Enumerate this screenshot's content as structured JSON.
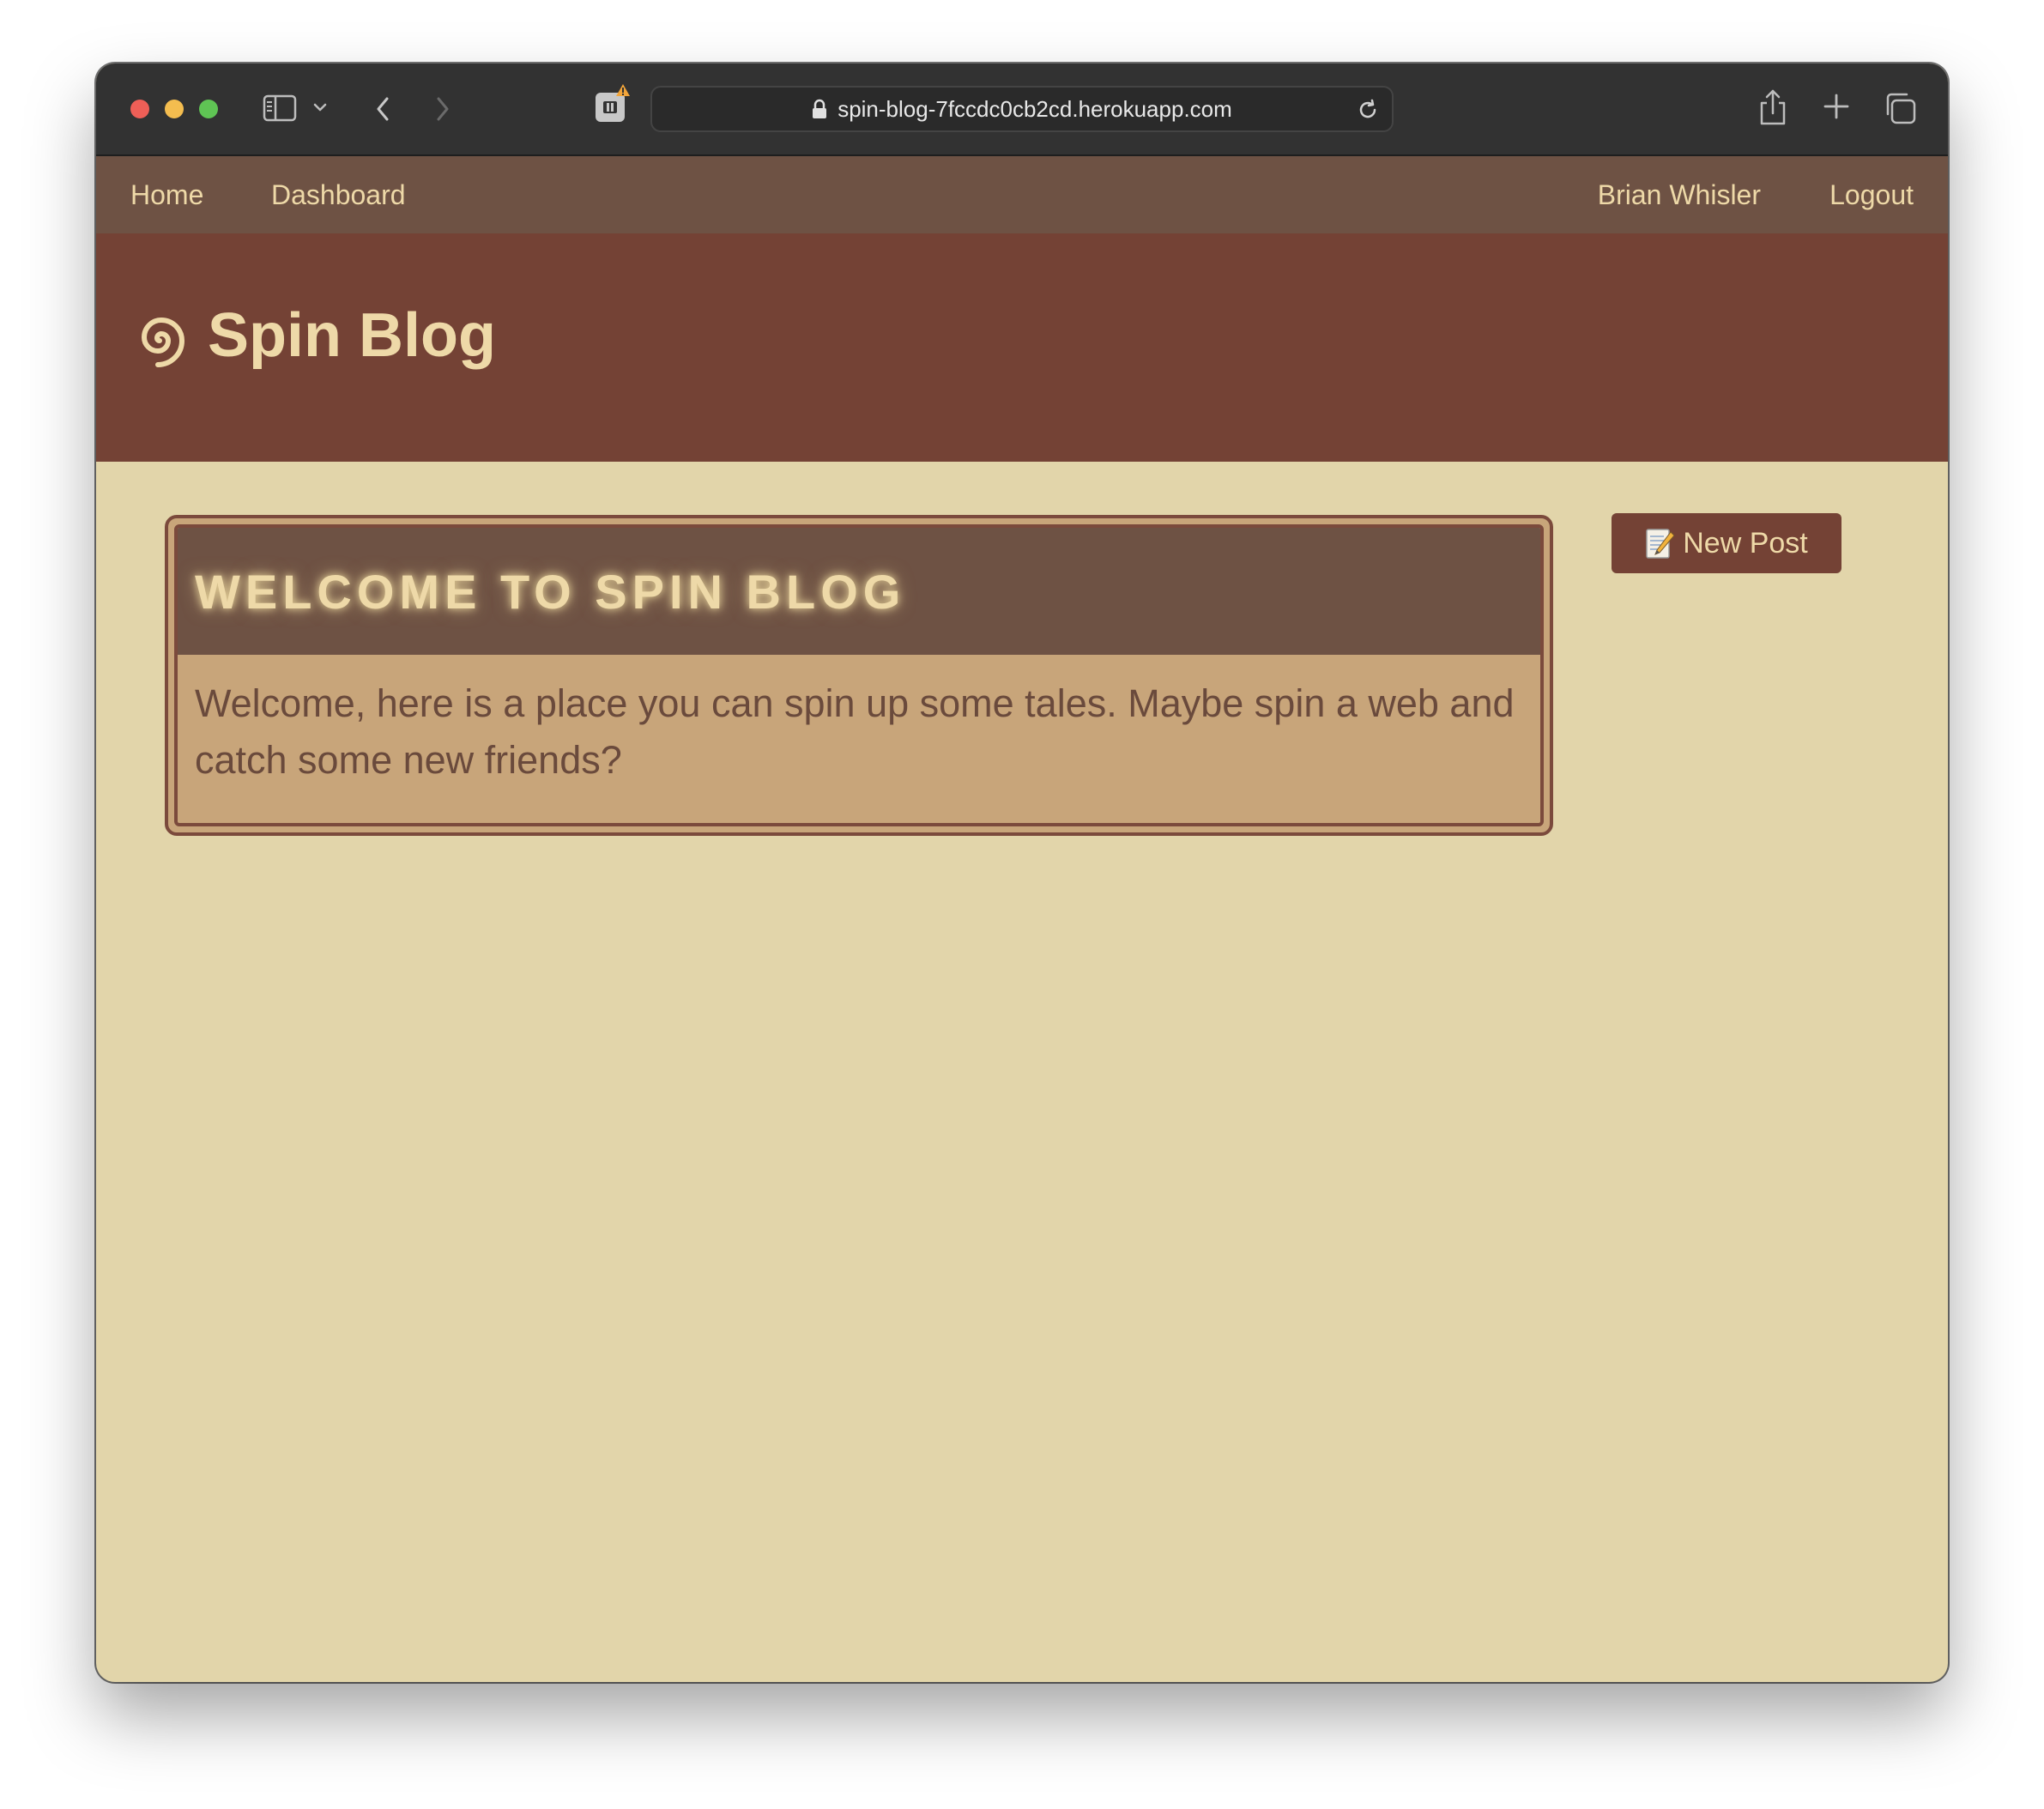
{
  "browser": {
    "url": "spin-blog-7fccdc0cb2cd.herokuapp.com"
  },
  "nav": {
    "home": "Home",
    "dashboard": "Dashboard",
    "user": "Brian Whisler",
    "logout": "Logout"
  },
  "header": {
    "title": "Spin Blog",
    "icon": "spiral-icon"
  },
  "welcome": {
    "title": "Welcome to Spin Blog",
    "body": "Welcome, here is a place you can spin up some tales. Maybe spin a web and catch some new friends?"
  },
  "actions": {
    "new_post_label": "New Post",
    "new_post_icon": "memo-icon"
  },
  "colors": {
    "navbar": "#6e5244",
    "header": "#744235",
    "page_bg": "#e2d5aa",
    "card_bg": "#c8a57a",
    "accent_text": "#eed9a8"
  }
}
